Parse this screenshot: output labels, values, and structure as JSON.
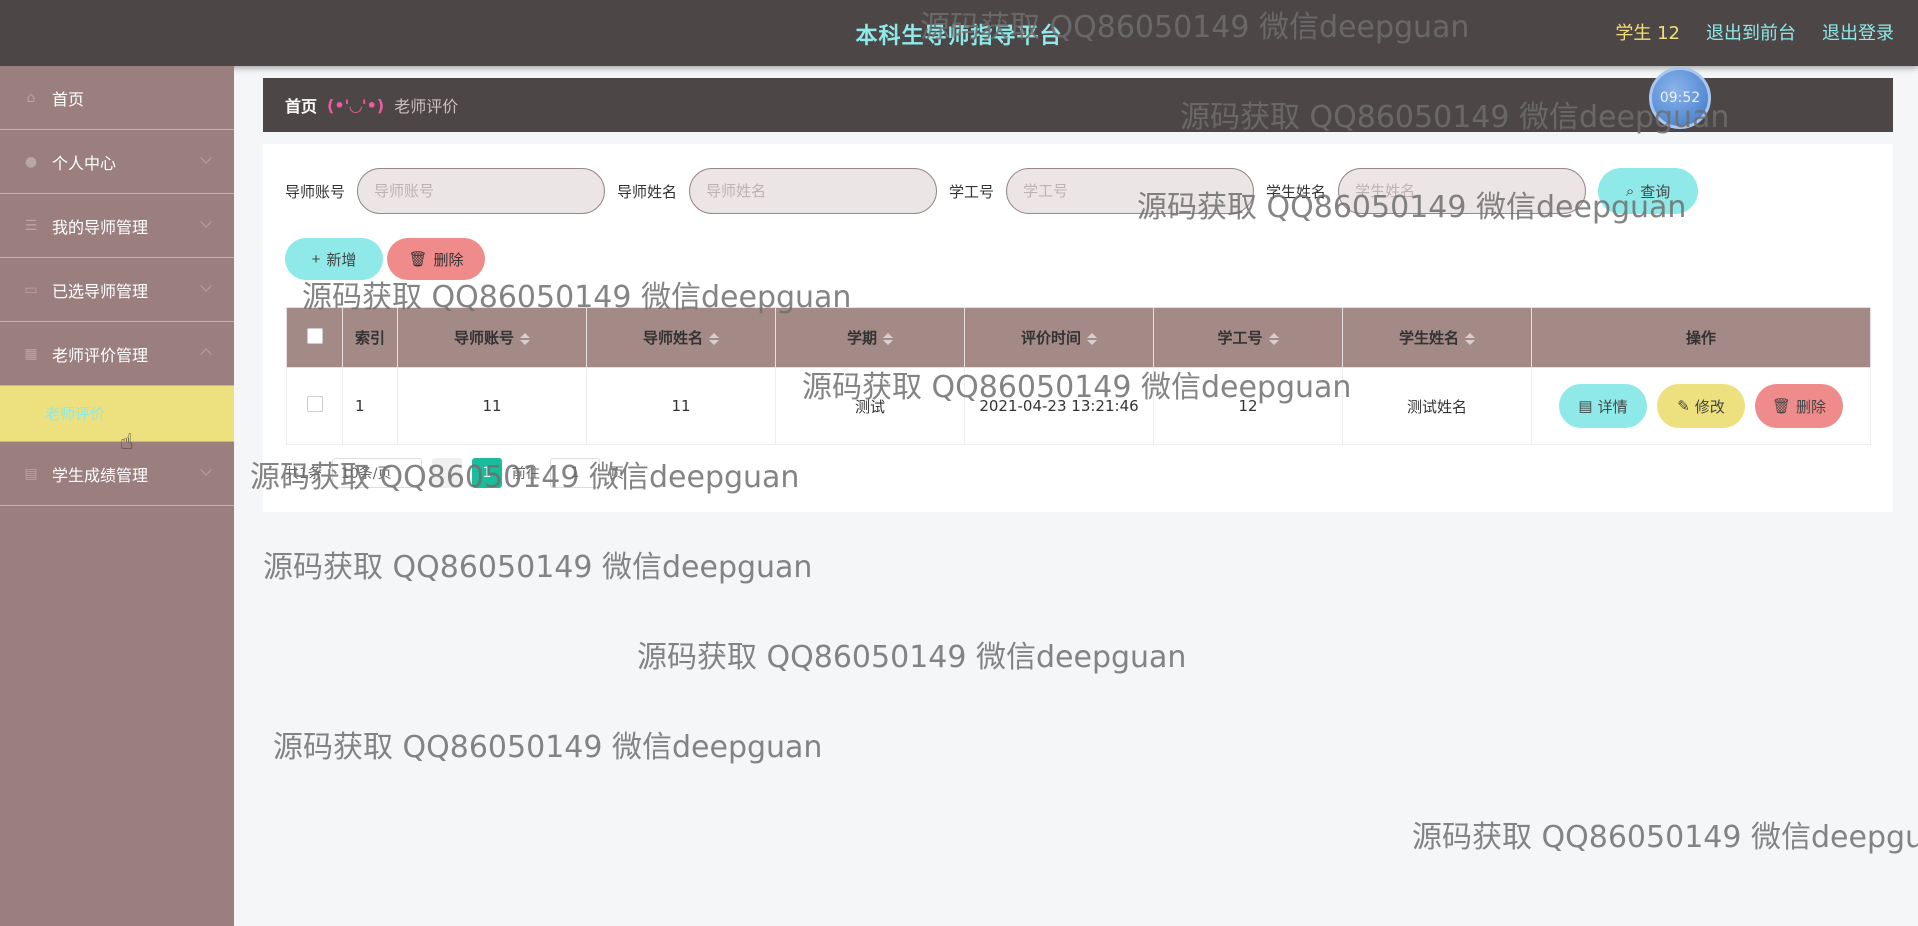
{
  "header": {
    "title": "本科生导师指导平台",
    "user": "学生 12",
    "to_front": "退出到前台",
    "logout": "退出登录"
  },
  "sidebar": {
    "items": [
      {
        "label": "首页"
      },
      {
        "label": "个人中心"
      },
      {
        "label": "我的导师管理"
      },
      {
        "label": "已选导师管理"
      },
      {
        "label": "老师评价管理"
      },
      {
        "label": "学生成绩管理"
      }
    ],
    "sub_active": "老师评价"
  },
  "breadcrumb": {
    "home": "首页",
    "sep": "(•'◡'•)",
    "current": "老师评价"
  },
  "clock": "09:52",
  "search": {
    "fields": [
      {
        "label": "导师账号",
        "placeholder": "导师账号"
      },
      {
        "label": "导师姓名",
        "placeholder": "导师姓名"
      },
      {
        "label": "学工号",
        "placeholder": "学工号"
      },
      {
        "label": "学生姓名",
        "placeholder": "学生姓名"
      }
    ],
    "query_label": "查询"
  },
  "actions": {
    "add_label": "新增",
    "delete_label": "删除"
  },
  "table": {
    "columns": [
      "索引",
      "导师账号",
      "导师姓名",
      "学期",
      "评价时间",
      "学工号",
      "学生姓名",
      "操作"
    ],
    "rows": [
      [
        "1",
        "11",
        "11",
        "测试",
        "2021-04-23 13:21:46",
        "12",
        "测试姓名"
      ]
    ],
    "ops": {
      "detail": "详情",
      "edit": "修改",
      "remove": "删除"
    }
  },
  "pagination": {
    "total": "共1条",
    "page_size": "10条/页",
    "current_page": "1",
    "goto_label": "前往",
    "goto_value": "1",
    "page_suffix": "页"
  },
  "watermark": "源码获取 QQ86050149 微信deepguan"
}
